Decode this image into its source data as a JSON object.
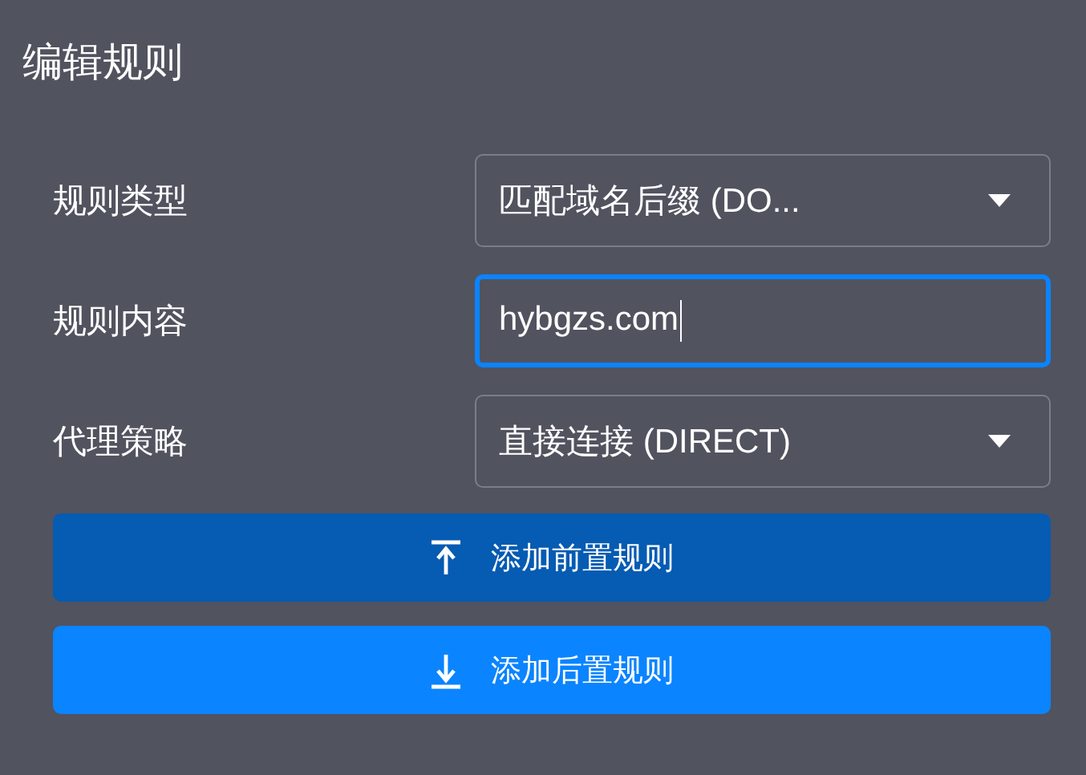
{
  "title": "编辑规则",
  "fields": [
    {
      "label": "规则类型",
      "kind": "select",
      "value": "匹配域名后缀 (DO...",
      "focused": false
    },
    {
      "label": "规则内容",
      "kind": "input",
      "value": "hybgzs.com",
      "focused": true
    },
    {
      "label": "代理策略",
      "kind": "select",
      "value": "直接连接 (DIRECT)",
      "focused": false
    }
  ],
  "buttons": [
    {
      "label": "添加前置规则",
      "kind": "top",
      "pressed": true
    },
    {
      "label": "添加后置规则",
      "kind": "bottom",
      "pressed": false
    }
  ]
}
